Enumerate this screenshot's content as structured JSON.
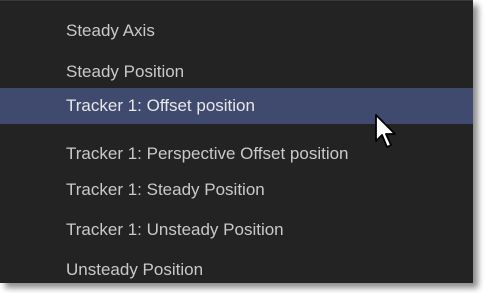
{
  "menu": {
    "items": [
      {
        "label": "Steady Axis",
        "selected": false
      },
      {
        "label": "Steady Position",
        "selected": false
      },
      {
        "label": "Tracker 1: Offset position",
        "selected": true
      },
      {
        "label": "Tracker 1: Perspective Offset position",
        "selected": false
      },
      {
        "label": "Tracker 1: Steady Position",
        "selected": false
      },
      {
        "label": "Tracker 1: Unsteady Position",
        "selected": false
      },
      {
        "label": "Unsteady Position",
        "selected": false
      }
    ]
  },
  "colors": {
    "menu_background": "#232323",
    "selection": "#3f4a6e",
    "text": "#c9c9c9"
  },
  "icons": {
    "cursor": "mouse-pointer-icon"
  }
}
